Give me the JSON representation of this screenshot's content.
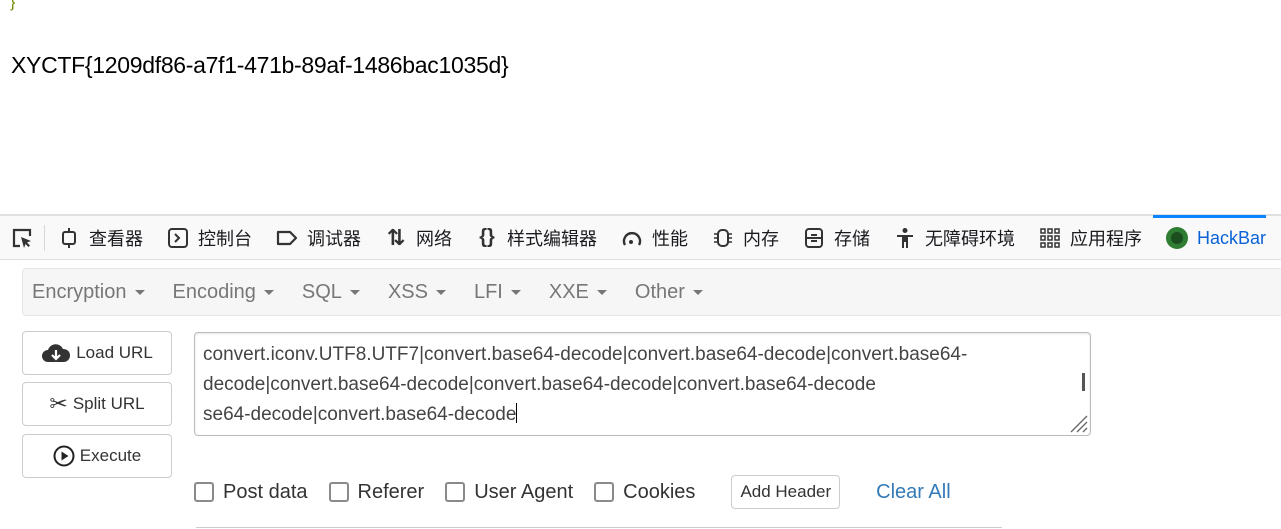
{
  "page": {
    "brace": "}",
    "flag": "XYCTF{1209df86-a7f1-471b-89af-1486bac1035d}"
  },
  "devtools": {
    "tabs": [
      {
        "label": "查看器",
        "icon": "inspector-icon"
      },
      {
        "label": "控制台",
        "icon": "console-icon"
      },
      {
        "label": "调试器",
        "icon": "debugger-icon"
      },
      {
        "label": "网络",
        "icon": "network-icon"
      },
      {
        "label": "样式编辑器",
        "icon": "style-editor-icon"
      },
      {
        "label": "性能",
        "icon": "performance-icon"
      },
      {
        "label": "内存",
        "icon": "memory-icon"
      },
      {
        "label": "存储",
        "icon": "storage-icon"
      },
      {
        "label": "无障碍环境",
        "icon": "accessibility-icon"
      },
      {
        "label": "应用程序",
        "icon": "application-icon"
      },
      {
        "label": "HackBar",
        "icon": "hackbar-icon"
      }
    ],
    "active": "HackBar",
    "accent": "#0a84ff"
  },
  "hackbar": {
    "menu": [
      "Encryption",
      "Encoding",
      "SQL",
      "XSS",
      "LFI",
      "XXE",
      "Other"
    ],
    "buttons": {
      "load": "Load URL",
      "split": "Split URL",
      "execute": "Execute"
    },
    "url_lines": [
      "convert.iconv.UTF8.UTF7|convert.base64-decode|convert.base64-decode|convert.base64-",
      "decode|convert.base64-decode|convert.base64-decode|convert.base64-decode",
      "se64-decode|convert.base64-decode"
    ],
    "options": {
      "post": "Post data",
      "referer": "Referer",
      "ua": "User Agent",
      "cookies": "Cookies"
    },
    "add_header": "Add Header",
    "clear_all": "Clear All",
    "link_color": "#337ab7"
  }
}
